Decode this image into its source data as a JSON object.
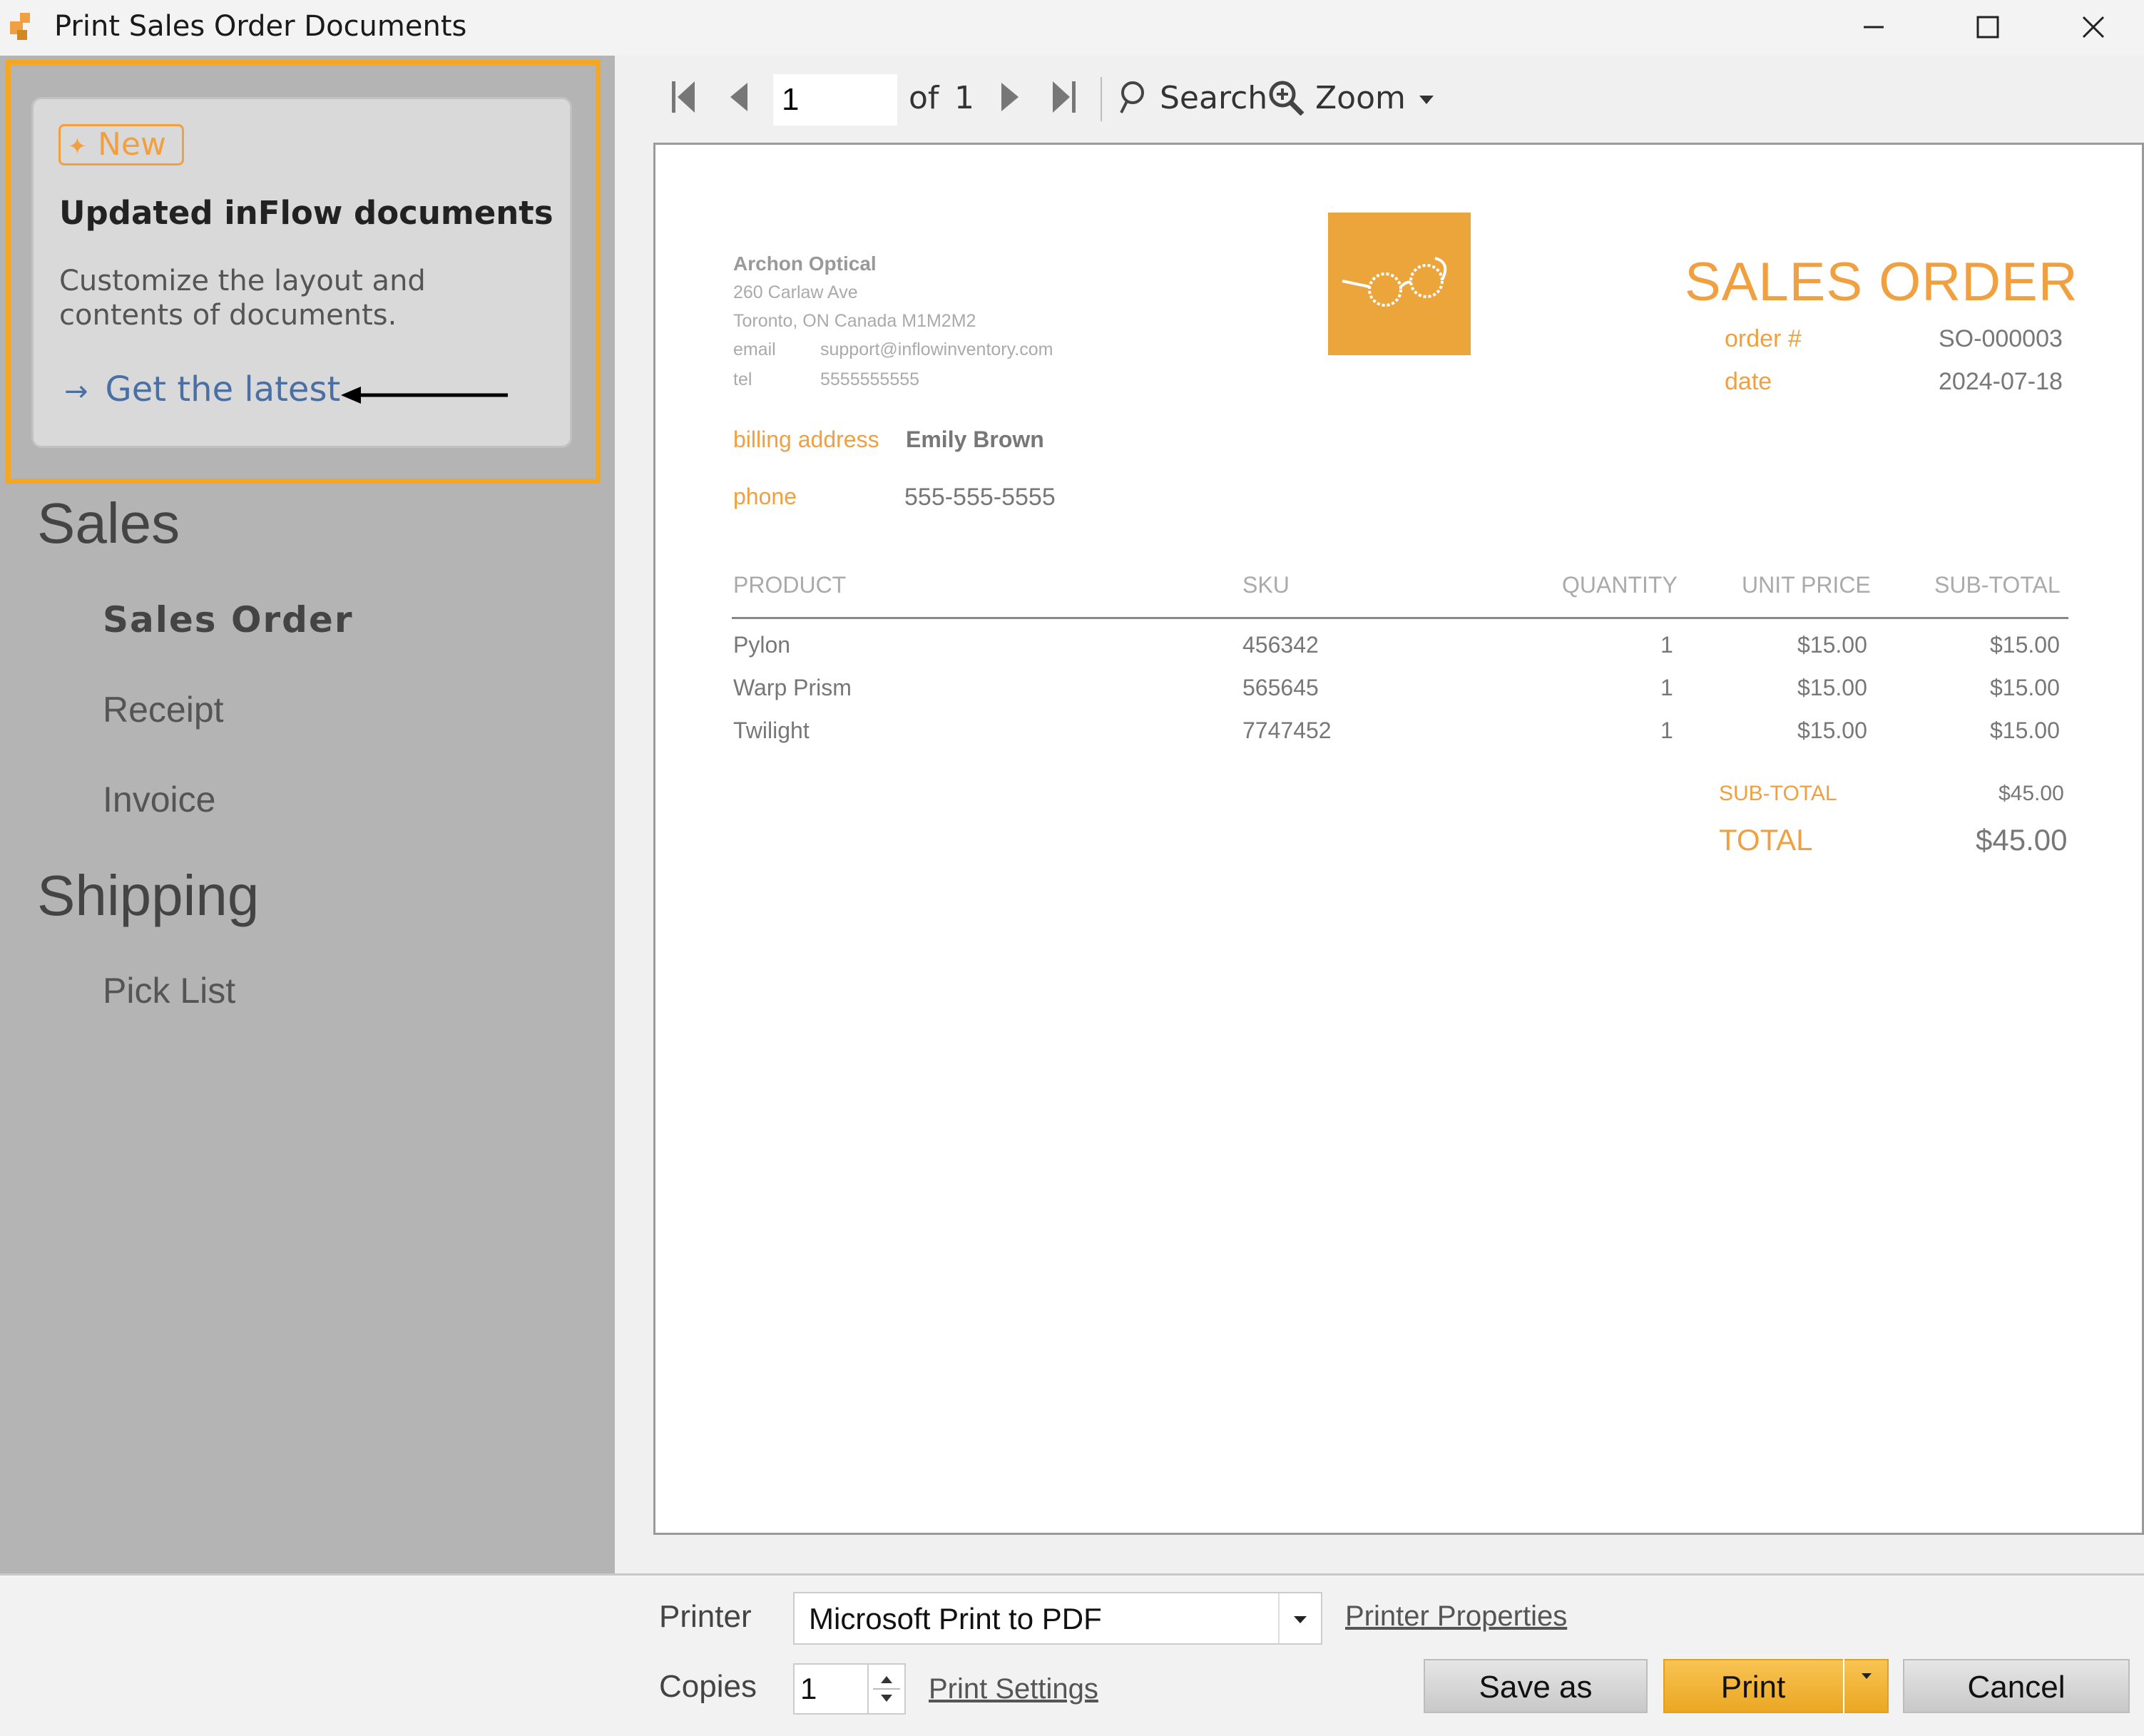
{
  "window": {
    "title": "Print Sales Order Documents"
  },
  "promo": {
    "badge": "New",
    "title": "Updated inFlow documents",
    "description": "Customize the layout and contents of documents.",
    "link": "Get the latest",
    "highlight_color": "#f5a623"
  },
  "nav": {
    "sales_header": "Sales",
    "sales_items": [
      "Sales Order",
      "Receipt",
      "Invoice"
    ],
    "shipping_header": "Shipping",
    "shipping_items": [
      "Pick List"
    ],
    "selected": "Sales Order"
  },
  "toolbar": {
    "page_value": "1",
    "of_label": "of",
    "total_pages": "1",
    "search_label": "Search",
    "zoom_label": "Zoom"
  },
  "document": {
    "company": {
      "name": "Archon Optical",
      "address_line1": "260 Carlaw Ave",
      "address_line2": "Toronto, ON  Canada  M1M2M2",
      "email_label": "email",
      "email": "support@inflowinventory.com",
      "tel_label": "tel",
      "tel": "5555555555"
    },
    "title": "SALES ORDER",
    "order_label": "order #",
    "order_number": "SO-000003",
    "date_label": "date",
    "date": "2024-07-18",
    "billing_label": "billing address",
    "billing_name": "Emily Brown",
    "phone_label": "phone",
    "phone": "555-555-5555",
    "columns": [
      "PRODUCT",
      "SKU",
      "QUANTITY",
      "UNIT PRICE",
      "SUB-TOTAL"
    ],
    "rows": [
      {
        "product": "Pylon",
        "sku": "456342",
        "qty": "1",
        "unit": "$15.00",
        "sub": "$15.00"
      },
      {
        "product": "Warp Prism",
        "sku": "565645",
        "qty": "1",
        "unit": "$15.00",
        "sub": "$15.00"
      },
      {
        "product": "Twilight",
        "sku": "7747452",
        "qty": "1",
        "unit": "$15.00",
        "sub": "$15.00"
      }
    ],
    "subtotal_label": "SUB-TOTAL",
    "subtotal": "$45.00",
    "total_label": "TOTAL",
    "total": "$45.00",
    "accent_color": "#f0a040",
    "logo_color": "#eca53a"
  },
  "bottom": {
    "printer_label": "Printer",
    "printer_value": "Microsoft Print to PDF",
    "printer_properties": "Printer Properties",
    "copies_label": "Copies",
    "copies_value": "1",
    "print_settings": "Print Settings",
    "save_as": "Save as",
    "print": "Print",
    "cancel": "Cancel"
  }
}
